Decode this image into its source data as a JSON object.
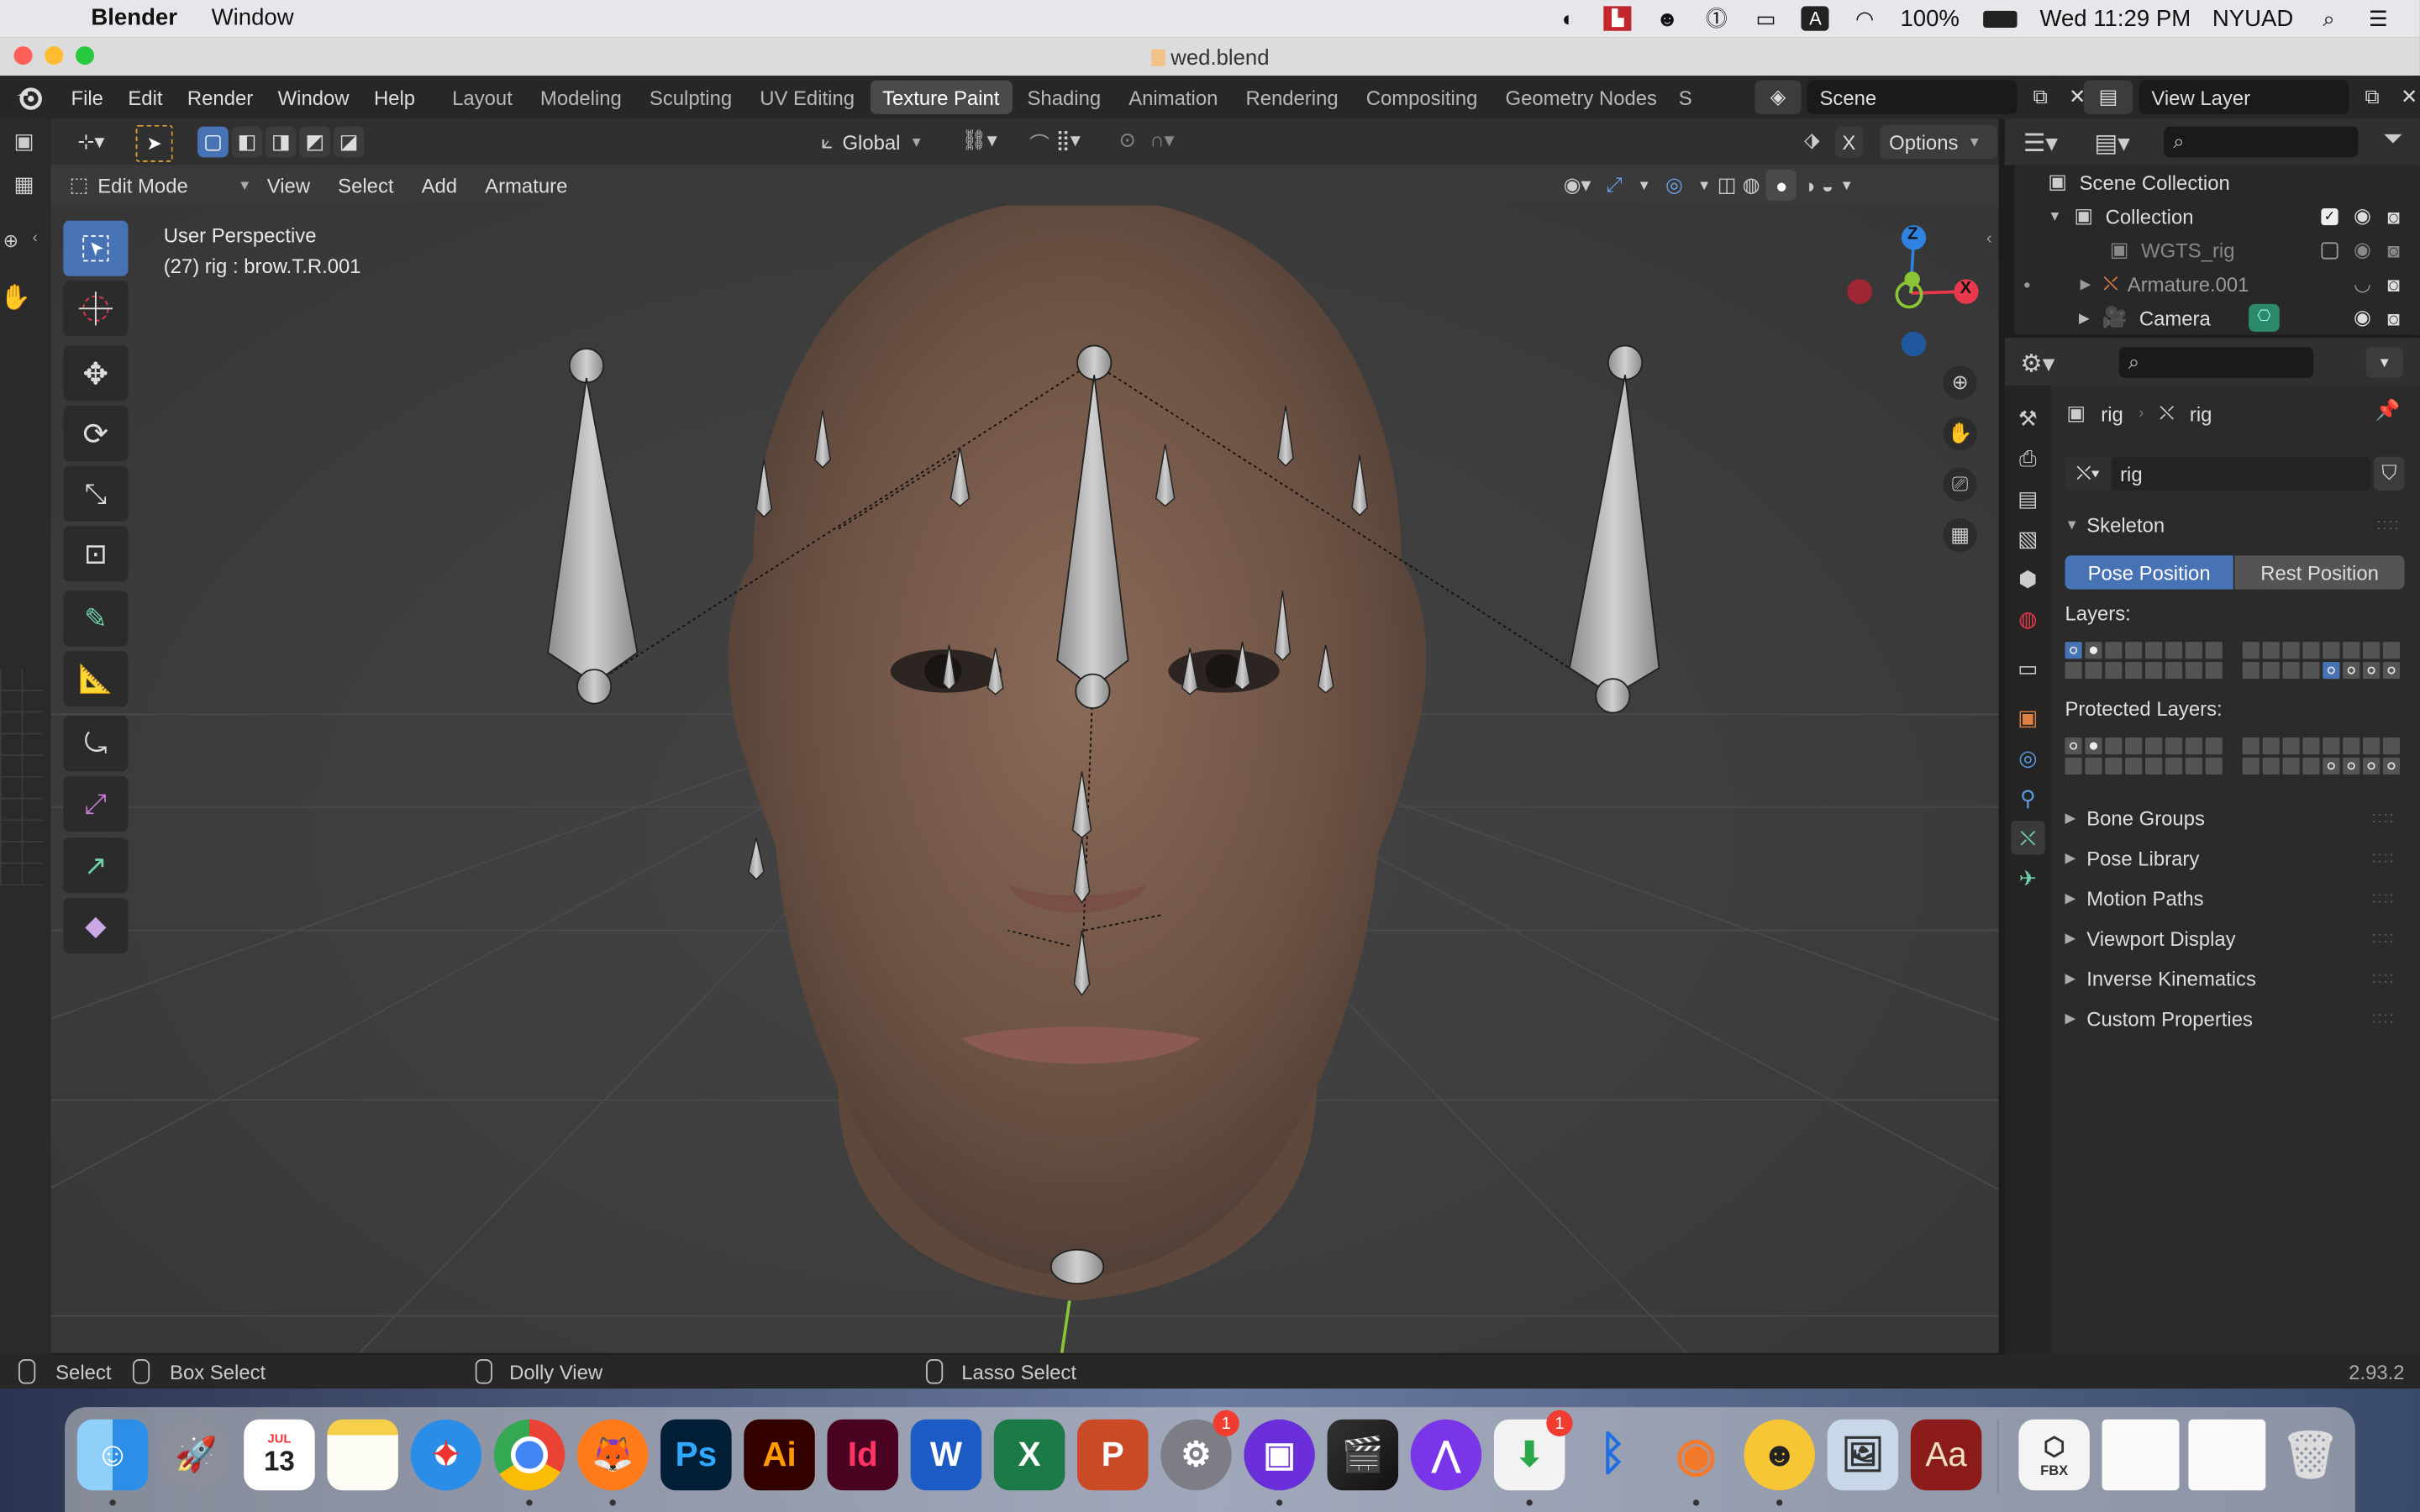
{
  "menubar": {
    "app_name": "Blender",
    "menu_window": "Window",
    "battery": "100%",
    "clock": "Wed 11:29 PM",
    "user": "NYUAD",
    "input_source": "A"
  },
  "window": {
    "title": "wed.blend"
  },
  "topbar": {
    "menus": [
      "File",
      "Edit",
      "Render",
      "Window",
      "Help"
    ],
    "workspaces": [
      "Layout",
      "Modeling",
      "Sculpting",
      "UV Editing",
      "Texture Paint",
      "Shading",
      "Animation",
      "Rendering",
      "Compositing",
      "Geometry Nodes"
    ],
    "active_workspace": "Texture Paint",
    "truncated_tab": "S",
    "scene": "Scene",
    "view_layer": "View Layer"
  },
  "toolheader": {
    "orientation": "Global",
    "options": "Options",
    "x_label": "X"
  },
  "viewheader": {
    "mode": "Edit Mode",
    "menus": [
      "View",
      "Select",
      "Add",
      "Armature"
    ]
  },
  "viewport": {
    "perspective": "User Perspective",
    "selection": "(27) rig : brow.T.R.001",
    "gizmo": {
      "z": "Z",
      "x": "X"
    }
  },
  "outliner": {
    "scene_collection": "Scene Collection",
    "items": [
      {
        "name": "Collection"
      },
      {
        "name": "WGTS_rig"
      },
      {
        "name": "Armature.001"
      },
      {
        "name": "Camera"
      }
    ]
  },
  "properties": {
    "breadcrumb_object": "rig",
    "breadcrumb_data": "rig",
    "data_name": "rig",
    "skeleton_header": "Skeleton",
    "pose_position": "Pose Position",
    "rest_position": "Rest Position",
    "layers_label": "Layers:",
    "protected_layers_label": "Protected Layers:",
    "collapsed_sections": [
      "Bone Groups",
      "Pose Library",
      "Motion Paths",
      "Viewport Display",
      "Inverse Kinematics",
      "Custom Properties"
    ]
  },
  "statusbar": {
    "select": "Select",
    "box_select": "Box Select",
    "dolly_view": "Dolly View",
    "lasso_select": "Lasso Select",
    "version": "2.93.2"
  },
  "dock": {
    "calendar_month": "JUL",
    "calendar_day": "13",
    "apps": [
      "Finder",
      "Launchpad",
      "Calendar",
      "Notes",
      "Safari",
      "Chrome",
      "Firefox",
      "Ps",
      "Ai",
      "Id",
      "W",
      "X",
      "P",
      "System Preferences",
      "Zoom",
      "Final Cut Pro",
      "Affinity",
      "App Installer",
      "Bluetooth",
      "Blender",
      "Cyberduck",
      "Preview",
      "Aa"
    ],
    "badge_settings": "1",
    "badge_installer": "1",
    "fbx_label": "FBX"
  },
  "colors": {
    "accent_blue": "#4772b3",
    "axis_x": "#e8394c",
    "axis_y": "#8bc536",
    "axis_z": "#2f83e0"
  }
}
